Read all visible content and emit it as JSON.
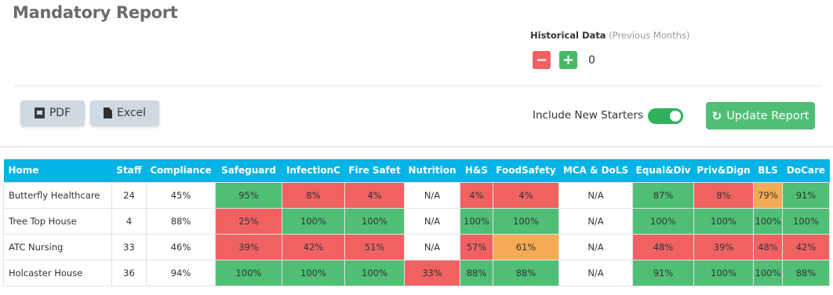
{
  "page_title": "Mandatory Report",
  "historical": {
    "label": "Historical Data",
    "sublabel": "(Previous Months)",
    "minus": "−",
    "plus": "+",
    "value": "0"
  },
  "buttons": {
    "pdf": "PDF",
    "excel": "Excel",
    "update": "Update Report"
  },
  "include_new_starters": {
    "label": "Include New Starters",
    "on": true
  },
  "colors": {
    "green": "#4fbf76",
    "red": "#f06262",
    "orange": "#f5ab55",
    "header": "#05b3e6"
  },
  "table": {
    "headers": [
      "Home",
      "Staff",
      "Compliance",
      "Safeguard",
      "InfectionC",
      "Fire Safet",
      "Nutrition",
      "H&S",
      "FoodSafety",
      "MCA & DoLS",
      "Equal&Div",
      "Priv&Dign",
      "BLS",
      "DoCare"
    ],
    "rows": [
      {
        "cells": [
          "Butterfly Healthcare",
          "24",
          "45%",
          "95%",
          "8%",
          "4%",
          "N/A",
          "4%",
          "4%",
          "N/A",
          "87%",
          "8%",
          "79%",
          "91%"
        ],
        "status": [
          "w",
          "w",
          "w",
          "g",
          "r",
          "r",
          "w",
          "r",
          "r",
          "w",
          "g",
          "r",
          "o",
          "g"
        ]
      },
      {
        "cells": [
          "Tree Top House",
          "4",
          "88%",
          "25%",
          "100%",
          "100%",
          "N/A",
          "100%",
          "100%",
          "N/A",
          "100%",
          "100%",
          "100%",
          "100%"
        ],
        "status": [
          "w",
          "w",
          "w",
          "r",
          "g",
          "g",
          "w",
          "g",
          "g",
          "w",
          "g",
          "g",
          "g",
          "g"
        ]
      },
      {
        "cells": [
          "ATC Nursing",
          "33",
          "46%",
          "39%",
          "42%",
          "51%",
          "N/A",
          "57%",
          "61%",
          "N/A",
          "48%",
          "39%",
          "48%",
          "42%"
        ],
        "status": [
          "w",
          "w",
          "w",
          "r",
          "r",
          "r",
          "w",
          "r",
          "o",
          "w",
          "r",
          "r",
          "r",
          "r"
        ]
      },
      {
        "cells": [
          "Holcaster House",
          "36",
          "94%",
          "100%",
          "100%",
          "100%",
          "33%",
          "88%",
          "88%",
          "N/A",
          "91%",
          "100%",
          "100%",
          "88%"
        ],
        "status": [
          "w",
          "w",
          "w",
          "g",
          "g",
          "g",
          "r",
          "g",
          "g",
          "w",
          "g",
          "g",
          "g",
          "g"
        ]
      }
    ]
  }
}
